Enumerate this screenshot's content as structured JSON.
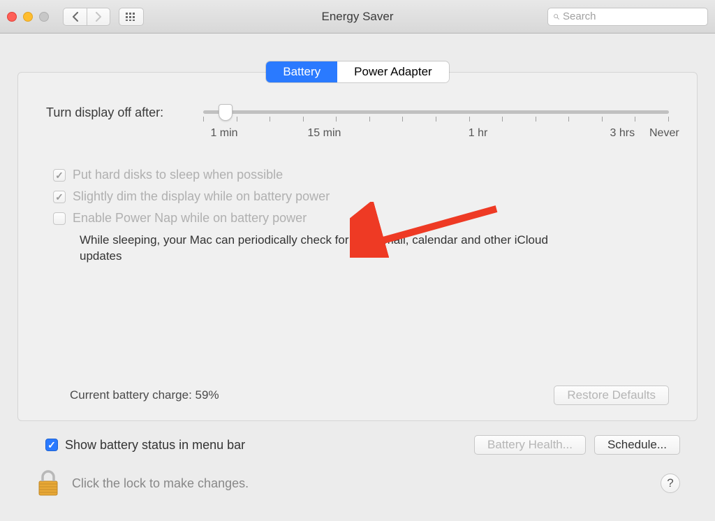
{
  "window": {
    "title": "Energy Saver",
    "search_placeholder": "Search"
  },
  "tabs": {
    "battery": "Battery",
    "power_adapter": "Power Adapter"
  },
  "slider": {
    "label": "Turn display off after:",
    "tick_1min": "1 min",
    "tick_15min": "15 min",
    "tick_1hr": "1 hr",
    "tick_3hrs": "3 hrs",
    "tick_never": "Never"
  },
  "checks": {
    "hard_disks": "Put hard disks to sleep when possible",
    "dim_display": "Slightly dim the display while on battery power",
    "power_nap": "Enable Power Nap while on battery power",
    "power_nap_desc": "While sleeping, your Mac can periodically check for new email, calendar and other iCloud updates"
  },
  "battery_charge": "Current battery charge: 59%",
  "buttons": {
    "restore_defaults": "Restore Defaults",
    "battery_health": "Battery Health...",
    "schedule": "Schedule..."
  },
  "menubar_check": "Show battery status in menu bar",
  "lock_text": "Click the lock to make changes."
}
